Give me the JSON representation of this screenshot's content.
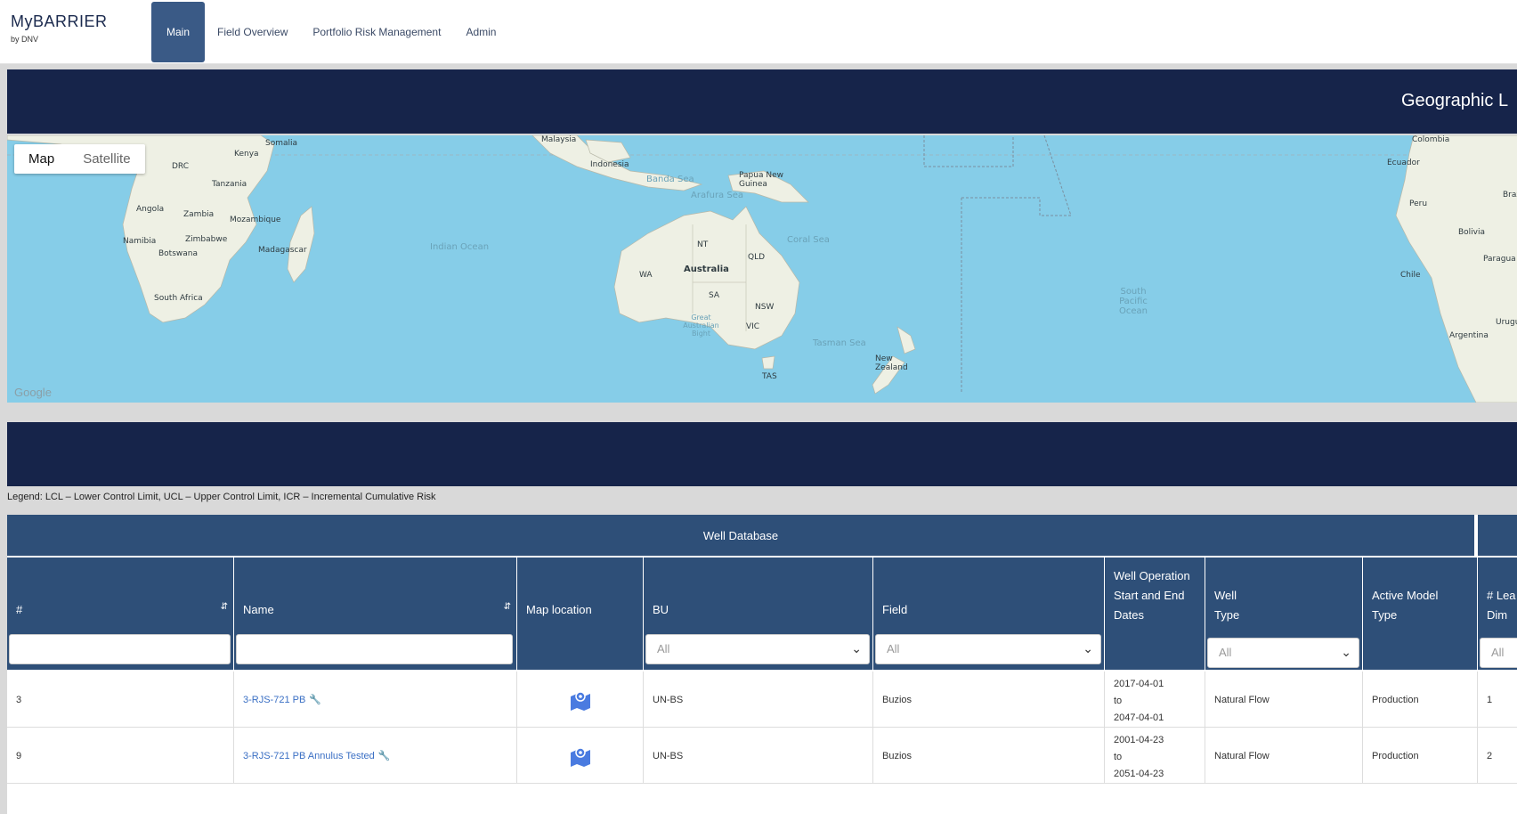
{
  "app": {
    "logo_main": "MyBARRIER",
    "logo_sub": "by DNV"
  },
  "nav": {
    "items": [
      {
        "label": "Main",
        "active": true
      },
      {
        "label": "Field Overview",
        "active": false
      },
      {
        "label": "Portfolio Risk Management",
        "active": false
      },
      {
        "label": "Admin",
        "active": false
      }
    ]
  },
  "geo_panel": {
    "title": "Geographic L"
  },
  "map": {
    "toggle_map": "Map",
    "toggle_satellite": "Satellite",
    "attribution": "Google",
    "labels": {
      "somalia": "Somalia",
      "kenya": "Kenya",
      "drc": "DRC",
      "tanzania": "Tanzania",
      "angola": "Angola",
      "zambia": "Zambia",
      "mozambique": "Mozambique",
      "namibia": "Namibia",
      "zimbabwe": "Zimbabwe",
      "botswana": "Botswana",
      "madagascar": "Madagascar",
      "south_africa": "South Africa",
      "indian_ocean": "Indian Ocean",
      "malaysia": "Malaysia",
      "indonesia": "Indonesia",
      "banda_sea": "Banda Sea",
      "arafura_sea": "Arafura Sea",
      "papua_new_guinea": "Papua New Guinea",
      "coral_sea": "Coral Sea",
      "australia": "Australia",
      "wa": "WA",
      "nt": "NT",
      "qld": "QLD",
      "sa": "SA",
      "nsw": "NSW",
      "vic": "VIC",
      "tas": "TAS",
      "great_australian_bight": "Great Australian Bight",
      "tasman_sea": "Tasman Sea",
      "new_zealand": "New Zealand",
      "south_pacific_ocean": "South Pacific Ocean",
      "colombia": "Colombia",
      "ecuador": "Ecuador",
      "peru": "Peru",
      "brazil": "Braz",
      "bolivia": "Bolivia",
      "paraguay": "Paragua",
      "chile": "Chile",
      "argentina": "Argentina",
      "uruguay": "Urugu"
    }
  },
  "legend": {
    "text": "Legend: LCL – Lower Control Limit, UCL – Upper Control Limit, ICR – Incremental Cumulative Risk"
  },
  "table": {
    "title": "Well Database",
    "headers": {
      "id": "#",
      "name": "Name",
      "map_location": "Map location",
      "bu": "BU",
      "field": "Field",
      "dates": "Well Operation Start and End Dates",
      "well_type": "Well Type",
      "model_type": "Active Model Type",
      "leak": "# Lea Dim"
    },
    "filters": {
      "bu": "All",
      "field": "All",
      "well_type": "All",
      "leak": "All"
    },
    "rows": [
      {
        "id": "3",
        "name": "3-RJS-721 PB",
        "bu": "UN-BS",
        "field": "Buzios",
        "start": "2017-04-01",
        "to": "to",
        "end": "2047-04-01",
        "well_type": "Natural Flow",
        "model_type": "Production",
        "leak": "1"
      },
      {
        "id": "9",
        "name": "3-RJS-721 PB Annulus Tested",
        "bu": "UN-BS",
        "field": "Buzios",
        "start": "2001-04-23",
        "to": "to",
        "end": "2051-04-23",
        "well_type": "Natural Flow",
        "model_type": "Production",
        "leak": "2"
      }
    ]
  },
  "colors": {
    "navy": "#16244a",
    "table_header": "#2e4f78",
    "ocean": "#86cde8",
    "land": "#eef0e4",
    "link": "#3a6fc4"
  }
}
